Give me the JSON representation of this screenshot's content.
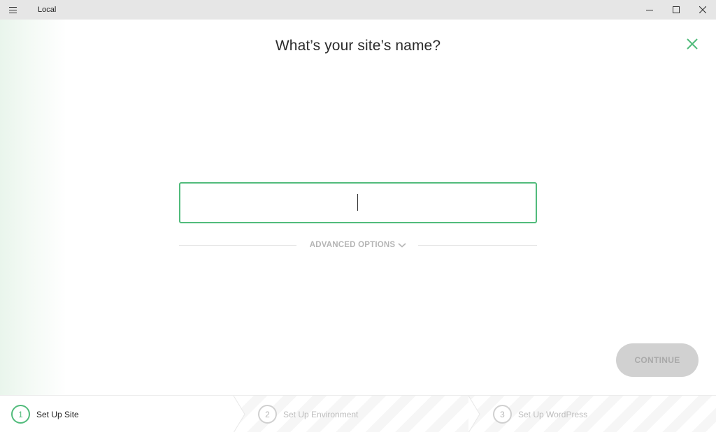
{
  "titlebar": {
    "title": "Local",
    "menu_icon": "hamburger-icon",
    "controls": [
      "minimize-icon",
      "maximize-icon",
      "close-icon"
    ]
  },
  "main": {
    "heading": "What’s your site’s name?",
    "close_icon": "close-icon",
    "site_name_input": {
      "value": "",
      "placeholder": ""
    },
    "advanced_options_label": "ADVANCED OPTIONS",
    "advanced_options_icon": "chevron-down-icon",
    "continue_label": "CONTINUE"
  },
  "steps": [
    {
      "number": "1",
      "label": "Set Up Site",
      "state": "active"
    },
    {
      "number": "2",
      "label": "Set Up Environment",
      "state": "inactive"
    },
    {
      "number": "3",
      "label": "Set Up WordPress",
      "state": "inactive"
    }
  ],
  "colors": {
    "accent": "#51bb7b",
    "titlebar_bg": "#e6e6e6",
    "button_disabled_bg": "#d1d1d1",
    "muted_text": "#b5b5b5"
  }
}
